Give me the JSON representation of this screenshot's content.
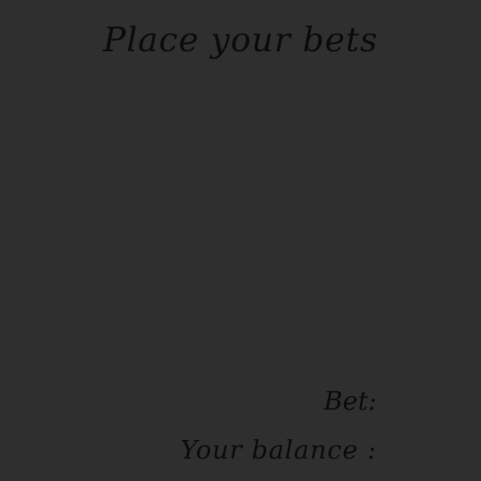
{
  "title": "Place your bets",
  "bet": {
    "label": "Bet:",
    "value": ""
  },
  "balance": {
    "label": "Your balance :",
    "value": ""
  },
  "colors": {
    "background": "#2f2f2f",
    "text": "#0b0b0b"
  }
}
